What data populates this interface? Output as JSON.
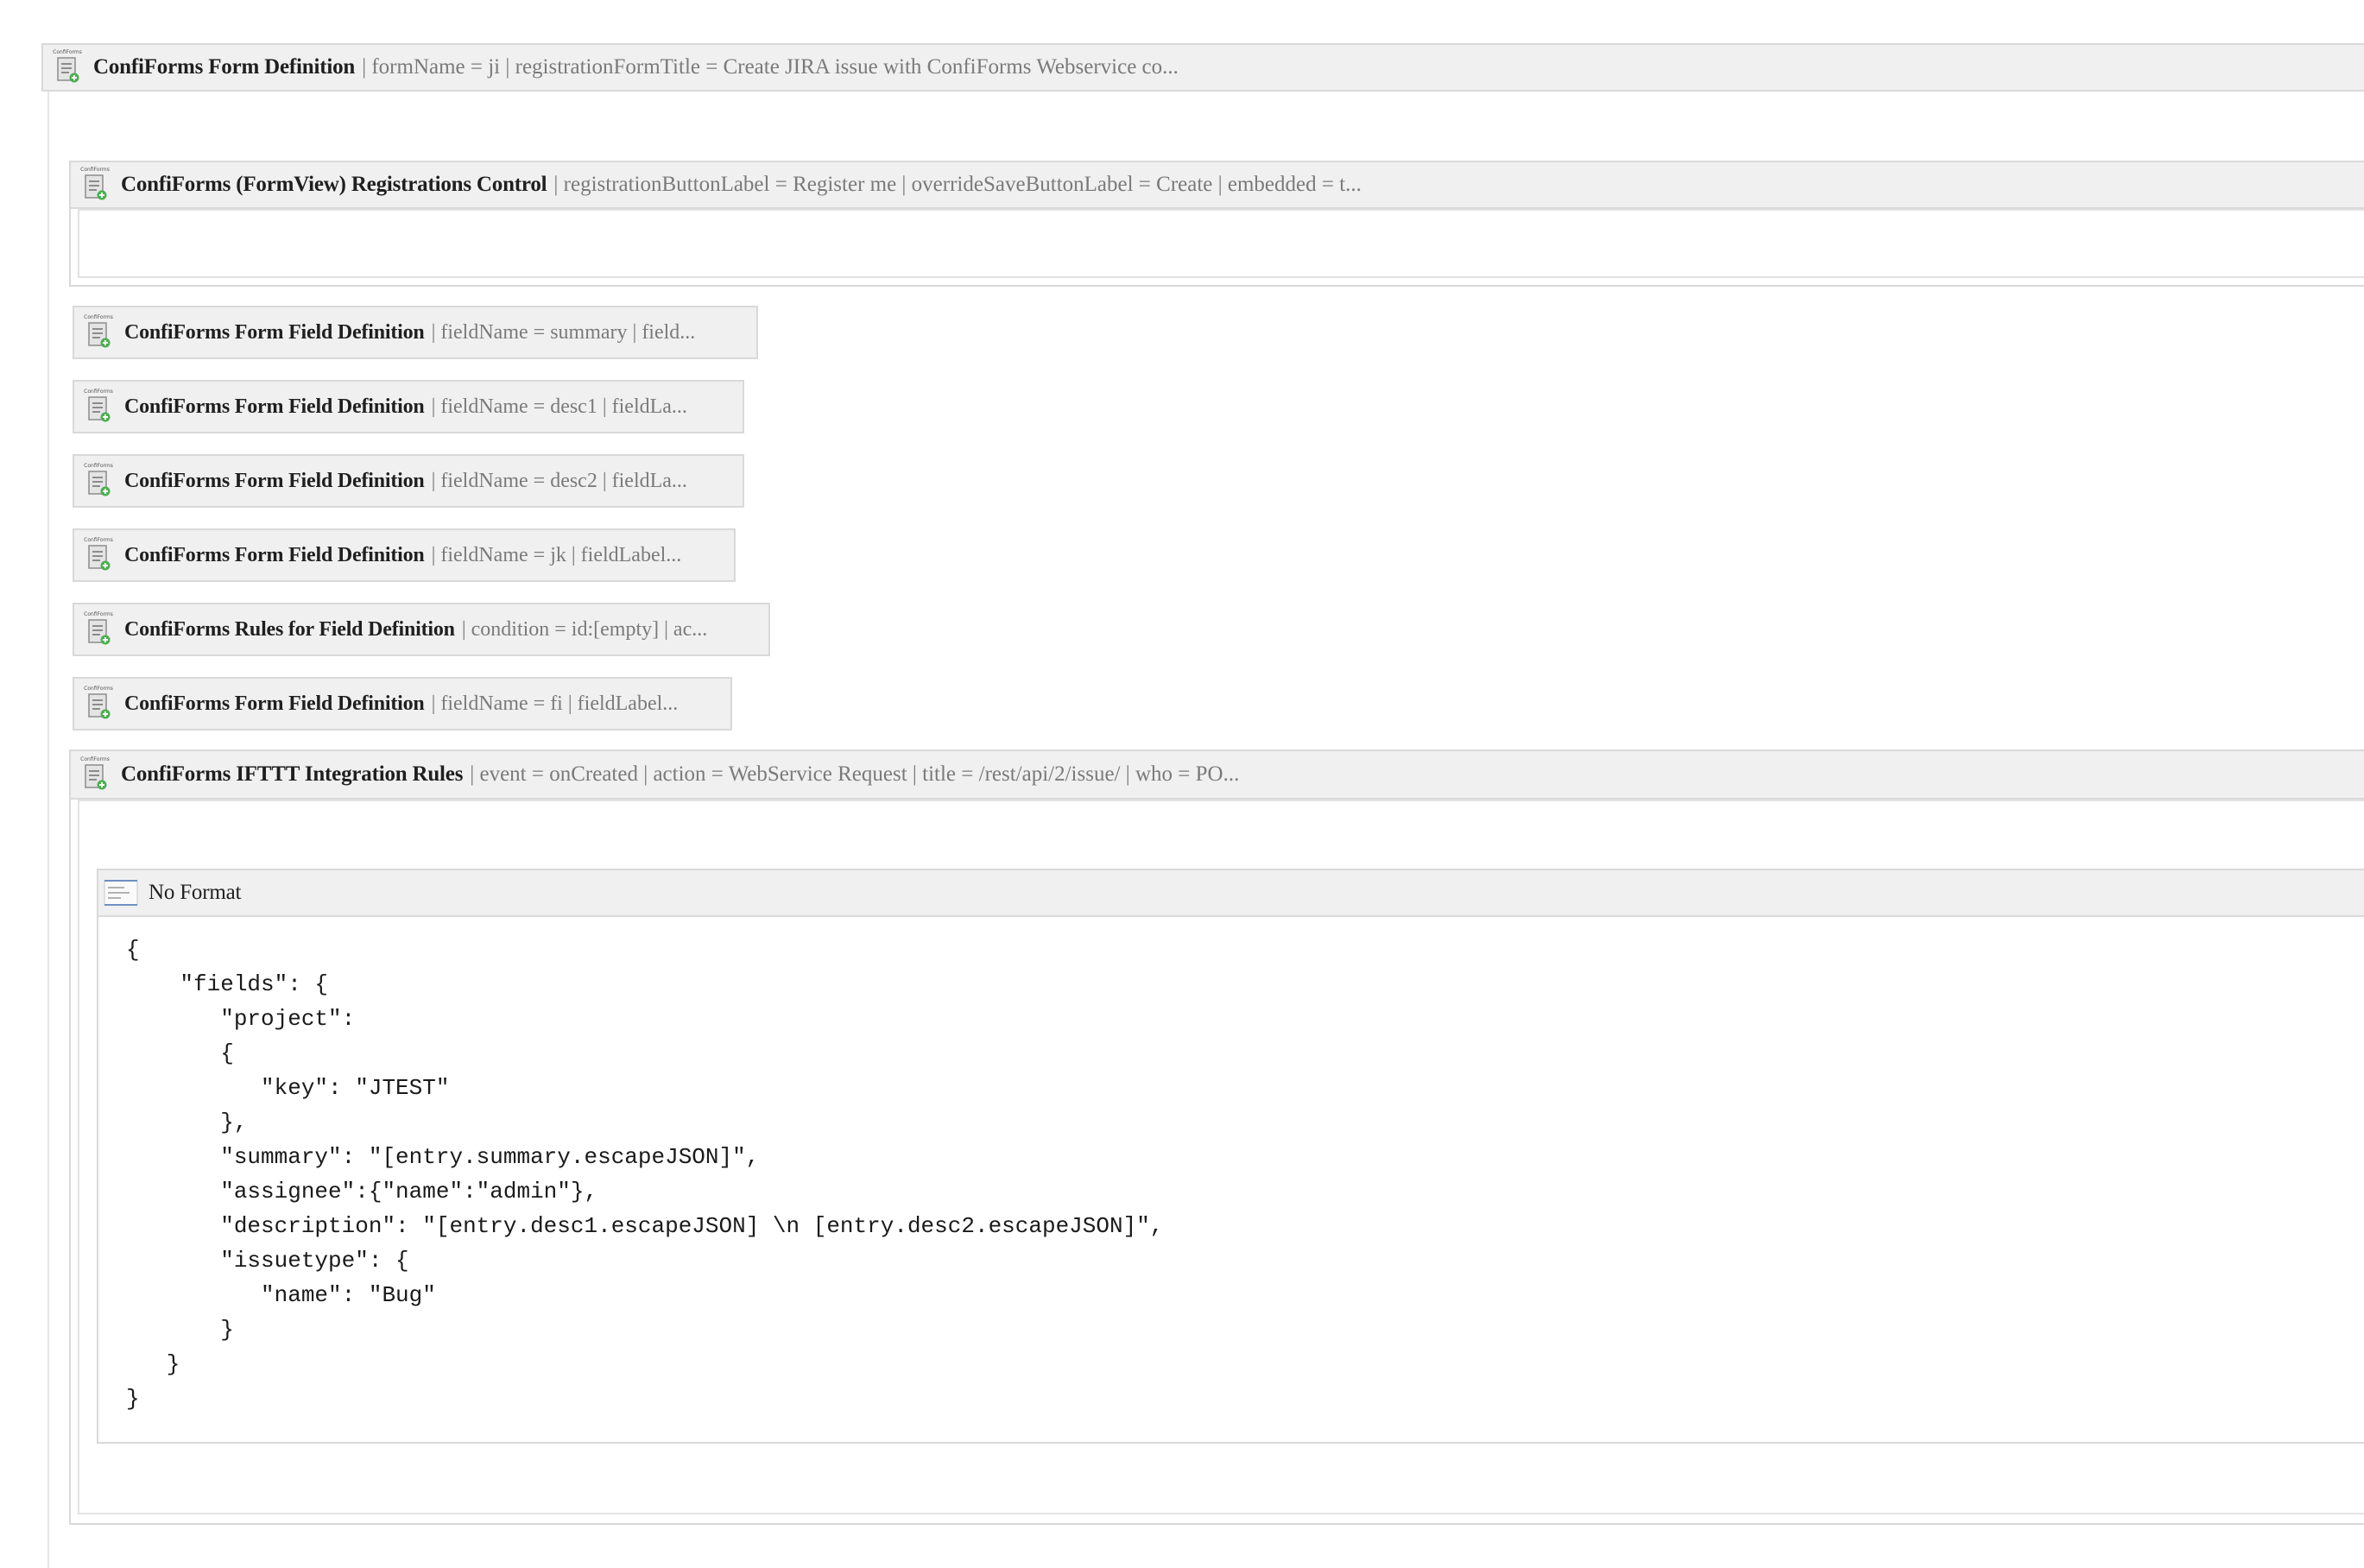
{
  "form_definition": {
    "name": "ConfiForms Form Definition",
    "params": "| formName = ji | registrationFormTitle = Create JIRA issue with ConfiForms Webservice co..."
  },
  "registrations_control": {
    "name": "ConfiForms (FormView) Registrations Control",
    "params": "| registrationButtonLabel = Register me | overrideSaveButtonLabel = Create | embedded = t..."
  },
  "field_macros": [
    {
      "name": "ConfiForms Form Field Definition",
      "params": "| fieldName = summary | field..."
    },
    {
      "name": "ConfiForms Form Field Definition",
      "params": "| fieldName = desc1 | fieldLa..."
    },
    {
      "name": "ConfiForms Form Field Definition",
      "params": "| fieldName = desc2 | fieldLa..."
    },
    {
      "name": "ConfiForms Form Field Definition",
      "params": "| fieldName = jk | fieldLabel..."
    },
    {
      "name": "ConfiForms Rules for Field Definition",
      "params": "| condition = id:[empty] | ac..."
    },
    {
      "name": "ConfiForms Form Field Definition",
      "params": "| fieldName = fi | fieldLabel..."
    }
  ],
  "ifttt_rules": {
    "name": "ConfiForms IFTTT Integration Rules",
    "params": "| event = onCreated | action = WebService Request | title = /rest/api/2/issue/ | who = PO..."
  },
  "no_format": {
    "title": "No Format",
    "code": "{\n    \"fields\": {\n       \"project\":\n       {\n          \"key\": \"JTEST\"\n       },\n       \"summary\": \"[entry.summary.escapeJSON]\",\n       \"assignee\":{\"name\":\"admin\"},\n       \"description\": \"[entry.desc1.escapeJSON] \\n [entry.desc2.escapeJSON]\",\n       \"issuetype\": {\n          \"name\": \"Bug\"\n       }\n   }\n}"
  },
  "icons": {
    "macro_icon": "confiforms-icon",
    "macro_icon_label": "ConfiForms",
    "no_format_icon": "no-format-icon"
  }
}
